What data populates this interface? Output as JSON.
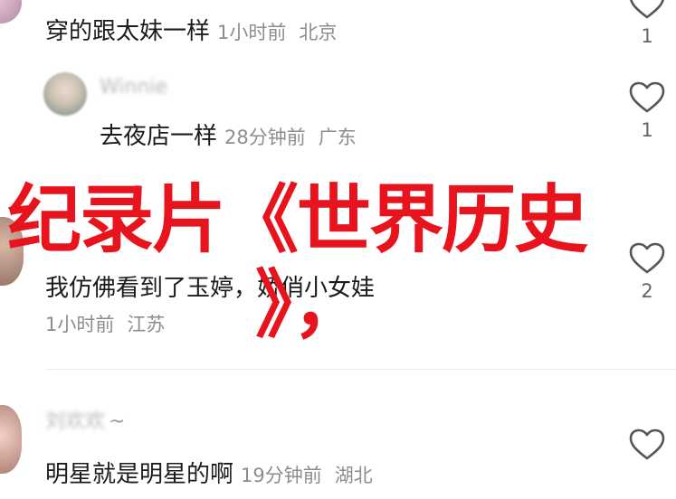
{
  "comments": [
    {
      "text": "穿的跟太妹一样",
      "time": "1小时前",
      "location": "北京",
      "likes": "1"
    },
    {
      "username": "Winnie",
      "text": "去夜店一样",
      "time": "28分钟前",
      "location": "广东",
      "likes": "1"
    },
    {
      "text": "我仿佛看到了玉婷，娇俏小女娃",
      "time": "1小时前",
      "location": "江苏",
      "likes": "2"
    },
    {
      "username": "刘欢欢",
      "username_suffix": "~",
      "text": "明星就是明星的啊",
      "time": "19分钟前",
      "location": "湖北"
    }
  ],
  "overlay": {
    "line1": "纪录片《世界历史",
    "line2": "》，"
  },
  "colors": {
    "overlay_red": "#e8141d",
    "meta_gray": "#8d8d8d"
  }
}
